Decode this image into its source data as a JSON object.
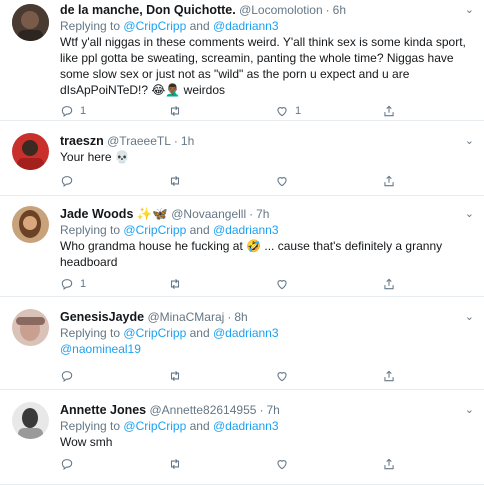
{
  "colors": {
    "link": "#1da1f2",
    "muted": "#657786",
    "text": "#14171a",
    "divider": "#e6ecf0"
  },
  "tweets": [
    {
      "name": "de la manche, Don Quichotte.",
      "handle": "@Locomolotion",
      "time": "6h",
      "reply_prefix": "Replying to",
      "reply_user1": "@CripCripp",
      "reply_and": "and",
      "reply_user2": "@dadriann3",
      "text": "Wtf y'all niggas in these comments weird. Y'all think sex is some kinda sport,\nlike ppl gotta be sweating, screamin, panting the whole time? Niggas have\nsome slow sex or just not as \"wild\" as the porn u expect and u are\ndIsApPoiNTeD!? 😂🤦🏾‍♂️ weirdos",
      "reply_count": "1",
      "retweet_count": "",
      "like_count": "1",
      "avatar_icon": "user-avatar-icon"
    },
    {
      "name": "traeszn",
      "handle": "@TraeeeTL",
      "time": "1h",
      "text": "Your here 💀",
      "reply_count": "",
      "retweet_count": "",
      "like_count": "",
      "avatar_icon": "user-avatar-icon"
    },
    {
      "name": "Jade Woods",
      "name_emoji": "✨🦋",
      "handle": "@Novaangelll",
      "time": "7h",
      "reply_prefix": "Replying to",
      "reply_user1": "@CripCripp",
      "reply_and": "and",
      "reply_user2": "@dadriann3",
      "text": "Who grandma house he fucking at 🤣 ... cause that's definitely a granny\nheadboard",
      "reply_count": "1",
      "retweet_count": "",
      "like_count": "",
      "avatar_icon": "user-avatar-icon"
    },
    {
      "name": "GenesisJayde",
      "handle": "@MinaCMaraj",
      "time": "8h",
      "reply_prefix": "Replying to",
      "reply_user1": "@CripCripp",
      "reply_and": "and",
      "reply_user2": "@dadriann3",
      "mention": "@naomineal19",
      "reply_count": "",
      "retweet_count": "",
      "like_count": "",
      "avatar_icon": "user-avatar-icon"
    },
    {
      "name": "Annette Jones",
      "handle": "@Annette82614955",
      "time": "7h",
      "reply_prefix": "Replying to",
      "reply_user1": "@CripCripp",
      "reply_and": "and",
      "reply_user2": "@dadriann3",
      "text": "Wow smh",
      "reply_count": "",
      "retweet_count": "",
      "like_count": "",
      "avatar_icon": "user-avatar-icon"
    }
  ],
  "dot": "·"
}
